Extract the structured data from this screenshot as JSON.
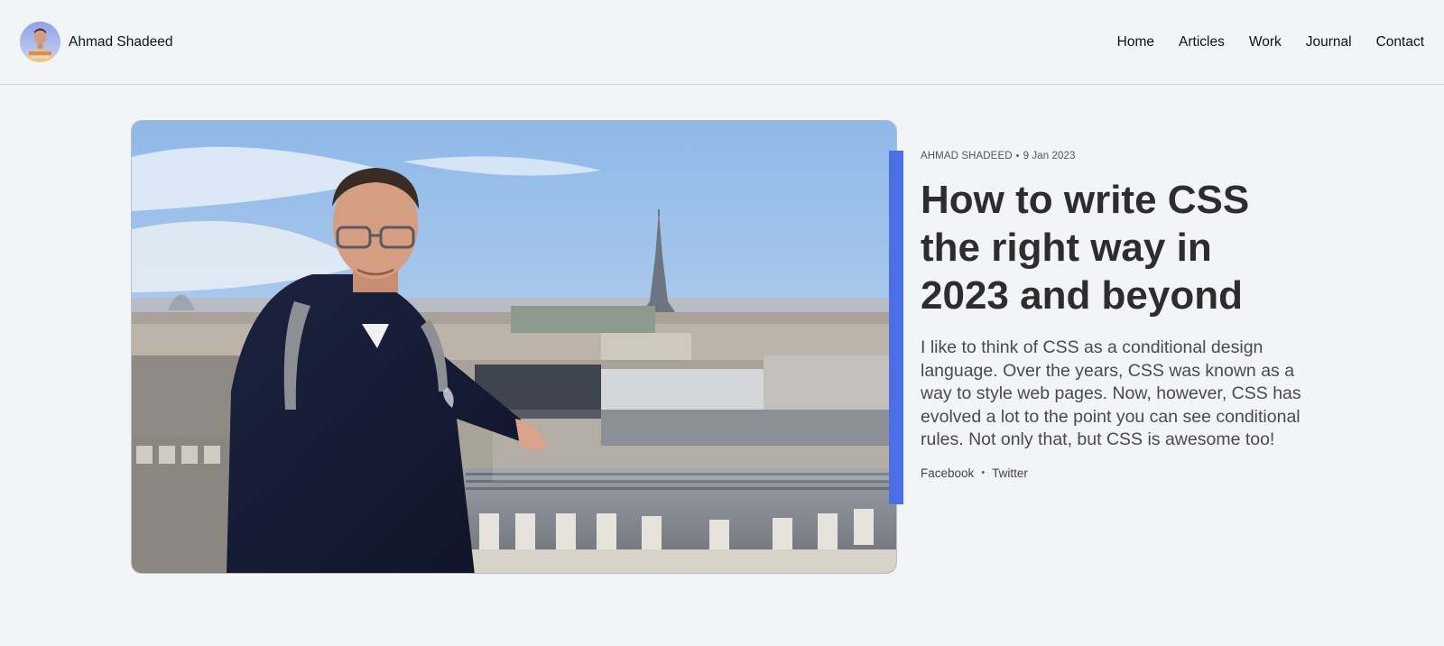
{
  "header": {
    "brand_name": "Ahmad Shadeed",
    "nav": [
      {
        "label": "Home"
      },
      {
        "label": "Articles"
      },
      {
        "label": "Work"
      },
      {
        "label": "Journal"
      },
      {
        "label": "Contact"
      }
    ]
  },
  "article": {
    "author": "AHMAD SHADEED",
    "meta_separator": "•",
    "date": "9 Jan 2023",
    "title": "How to write CSS the right way in 2023 and beyond",
    "excerpt": "I like to think of CSS as a conditional design language. Over the years, CSS was known as a way to style web pages. Now, however, CSS has evolved a lot to the point you can see conditional rules. Not only that, but CSS is awesome too!",
    "share": {
      "facebook": "Facebook",
      "separator": "•",
      "twitter": "Twitter"
    },
    "hero_image": "photo of a man in front of the Paris skyline with the Eiffel Tower",
    "accent_color": "#4b6fe6"
  },
  "icons": {
    "avatar": "avatar-photo"
  }
}
